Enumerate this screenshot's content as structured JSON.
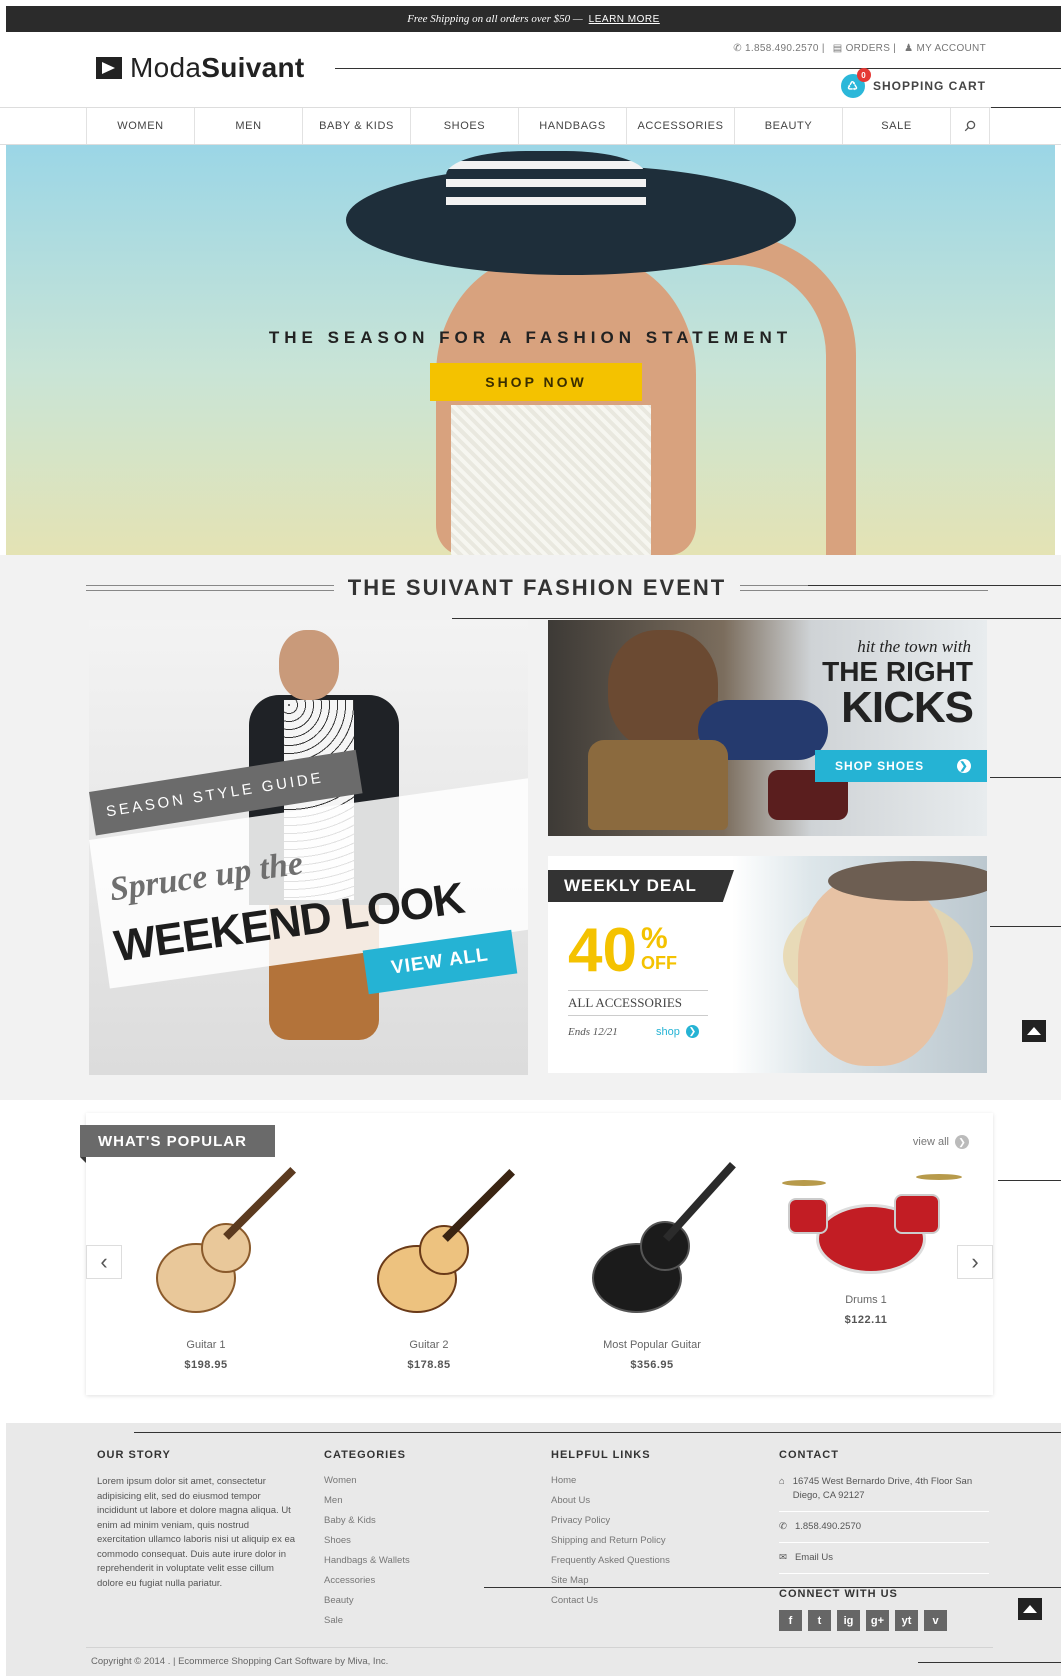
{
  "topbar": {
    "promo": "Free Shipping on all orders over $50 —",
    "learn_more": "LEARN MORE"
  },
  "header": {
    "logo_light": "Moda",
    "logo_bold": "Suivant",
    "phone": "1.858.490.2570 |",
    "orders": "ORDERS |",
    "account": "MY ACCOUNT",
    "cart_label": "SHOPPING CART",
    "cart_count": "0"
  },
  "nav": {
    "items": [
      "WOMEN",
      "MEN",
      "BABY & KIDS",
      "SHOES",
      "HANDBAGS",
      "ACCESSORIES",
      "BEAUTY",
      "SALE"
    ]
  },
  "hero": {
    "title": "THE SEASON FOR A FASHION STATEMENT",
    "button": "SHOP NOW"
  },
  "event": {
    "title": "THE SUIVANT FASHION EVENT"
  },
  "style_guide": {
    "band": "SEASON STYLE GUIDE",
    "script": "Spruce up the",
    "main": "WEEKEND LOOK",
    "button": "VIEW ALL"
  },
  "kicks": {
    "script": "hit the town with",
    "line1": "THE RIGHT",
    "line2": "KICKS",
    "button": "SHOP SHOES"
  },
  "deal": {
    "header": "WEEKLY DEAL",
    "percent": "40",
    "percent_sign": "%",
    "off": "OFF",
    "category": "ALL ACCESSORIES",
    "ends": "Ends 12/21",
    "shop": "shop"
  },
  "popular": {
    "title": "WHAT'S POPULAR",
    "view_all": "view all",
    "products": [
      {
        "name": "Guitar 1",
        "price": "$198.95"
      },
      {
        "name": "Guitar 2",
        "price": "$178.85"
      },
      {
        "name": "Most Popular Guitar",
        "price": "$356.95"
      },
      {
        "name": "Drums 1",
        "price": "$122.11"
      }
    ]
  },
  "footer": {
    "story_title": "OUR STORY",
    "story_text": "Lorem ipsum dolor sit amet, consectetur adipisicing elit, sed do eiusmod tempor incididunt ut labore et dolore magna aliqua. Ut enim ad minim veniam, quis nostrud exercitation ullamco laboris nisi ut aliquip ex ea commodo consequat. Duis aute irure dolor in reprehenderit in voluptate velit esse cillum dolore eu fugiat nulla pariatur.",
    "categories_title": "CATEGORIES",
    "categories": [
      "Women",
      "Men",
      "Baby & Kids",
      "Shoes",
      "Handbags & Wallets",
      "Accessories",
      "Beauty",
      "Sale"
    ],
    "helpful_title": "HELPFUL LINKS",
    "helpful": [
      "Home",
      "About Us",
      "Privacy Policy",
      "Shipping and Return Policy",
      "Frequently Asked Questions",
      "Site Map",
      "Contact Us"
    ],
    "contact_title": "CONTACT",
    "address": "16745 West Bernardo Drive, 4th Floor San Diego, CA 92127",
    "phone": "1.858.490.2570",
    "email": "Email Us",
    "connect_title": "CONNECT WITH US",
    "social": [
      "f",
      "t",
      "ig",
      "g+",
      "yt",
      "v"
    ],
    "copyright": "Copyright © 2014 . | Ecommerce Shopping Cart Software by Miva, Inc."
  }
}
